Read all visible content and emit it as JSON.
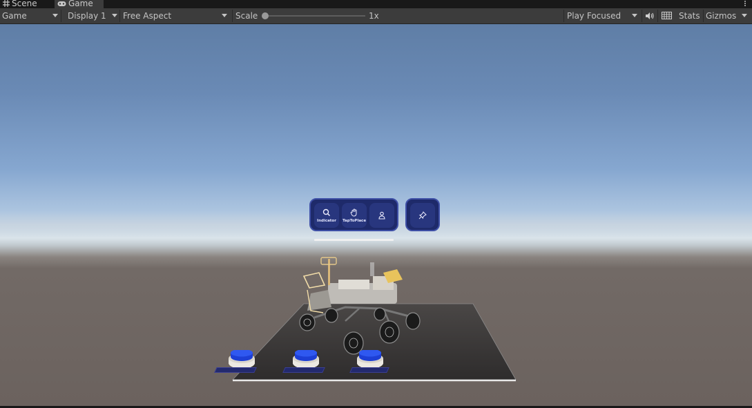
{
  "tabs": [
    {
      "label": "Scene",
      "icon": "grid-icon"
    },
    {
      "label": "Game",
      "icon": "gamepad-icon"
    }
  ],
  "toolbar": {
    "game_dropdown": "Game",
    "display_dropdown": "Display 1",
    "aspect_dropdown": "Free Aspect",
    "scale_label": "Scale",
    "scale_value": "1x",
    "scale_level": 0,
    "play_mode_dropdown": "Play Focused",
    "mute_icon": "speaker-icon",
    "stats_grid_icon": "keyboard-grid-icon",
    "stats_label": "Stats",
    "gizmos_label": "Gizmos"
  },
  "scene": {
    "near_menu": {
      "buttons": [
        {
          "label": "Indicator",
          "icon": "search-icon"
        },
        {
          "label": "TapToPlace",
          "icon": "hand-icon"
        },
        {
          "label": "",
          "icon": "person-icon"
        }
      ],
      "pin_icon": "pin-icon"
    },
    "platform_buttons": [
      {
        "color": "#2244dd"
      },
      {
        "color": "#2244dd"
      },
      {
        "color": "#2244dd"
      }
    ]
  },
  "colors": {
    "menu_background": "#1e2a6a",
    "menu_border": "#3e4fa6",
    "button_blue": "#2244dd",
    "toolbar": "#3c3c3c"
  }
}
